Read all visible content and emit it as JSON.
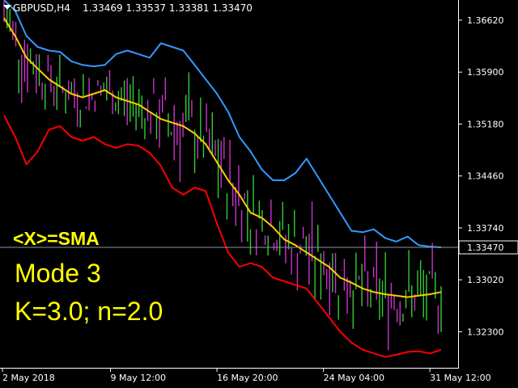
{
  "header": {
    "symbol": "GBPUSD,H4",
    "quote": "1.33469 1.33537 1.33381 1.33470"
  },
  "overlay": {
    "line1": "<X>=SMA",
    "line2": "Mode 3",
    "line3": "K=3.0; n=2.0"
  },
  "current_price_label": "1.33470",
  "colors": {
    "background": "#000000",
    "candle_up": "#33cc33",
    "candle_down": "#cc33cc",
    "upper_band": "#3399ff",
    "middle_line": "#ffcc00",
    "lower_band": "#ff0000",
    "overlay_text": "#ffff00",
    "axis": "#ffffff"
  },
  "chart_data": {
    "type": "line",
    "ylim": [
      1.318,
      1.369
    ],
    "y_ticks": [
      "1.36620",
      "1.35900",
      "1.35180",
      "1.34460",
      "1.33740",
      "1.33020",
      "1.32300"
    ],
    "x_ticks": [
      "2 May 2018",
      "9 May 12:00",
      "16 May 20:00",
      "24 May 04:00",
      "31 May 12:00"
    ],
    "current_price": 1.3347,
    "series": [
      {
        "key": "upper",
        "values": [
          1.369,
          1.3675,
          1.364,
          1.3625,
          1.362,
          1.3618,
          1.3605,
          1.36,
          1.3598,
          1.36,
          1.3615,
          1.362,
          1.3615,
          1.361,
          1.363,
          1.3625,
          1.362,
          1.36,
          1.358,
          1.356,
          1.3535,
          1.35,
          1.348,
          1.3455,
          1.344,
          1.344,
          1.345,
          1.347,
          1.3445,
          1.342,
          1.3395,
          1.337,
          1.3368,
          1.3372,
          1.336,
          1.3355,
          1.3362,
          1.335,
          1.3348,
          1.3347
        ]
      },
      {
        "key": "middle",
        "values": [
          1.3665,
          1.364,
          1.361,
          1.3595,
          1.358,
          1.357,
          1.356,
          1.3555,
          1.356,
          1.3565,
          1.3555,
          1.355,
          1.3545,
          1.3535,
          1.3525,
          1.352,
          1.3515,
          1.3505,
          1.349,
          1.3465,
          1.344,
          1.342,
          1.3395,
          1.3388,
          1.3375,
          1.3358,
          1.335,
          1.334,
          1.333,
          1.332,
          1.3305,
          1.3298,
          1.329,
          1.3285,
          1.3282,
          1.328,
          1.3278,
          1.328,
          1.3282,
          1.3285
        ]
      },
      {
        "key": "lower",
        "values": [
          1.353,
          1.35,
          1.3462,
          1.348,
          1.351,
          1.3515,
          1.35,
          1.3495,
          1.35,
          1.349,
          1.3485,
          1.349,
          1.3488,
          1.3478,
          1.346,
          1.343,
          1.342,
          1.343,
          1.3425,
          1.338,
          1.334,
          1.332,
          1.3325,
          1.332,
          1.3305,
          1.33,
          1.3295,
          1.329,
          1.327,
          1.325,
          1.323,
          1.3215,
          1.3205,
          1.32,
          1.3195,
          1.3198,
          1.3202,
          1.3203,
          1.32,
          1.3205
        ]
      }
    ]
  }
}
